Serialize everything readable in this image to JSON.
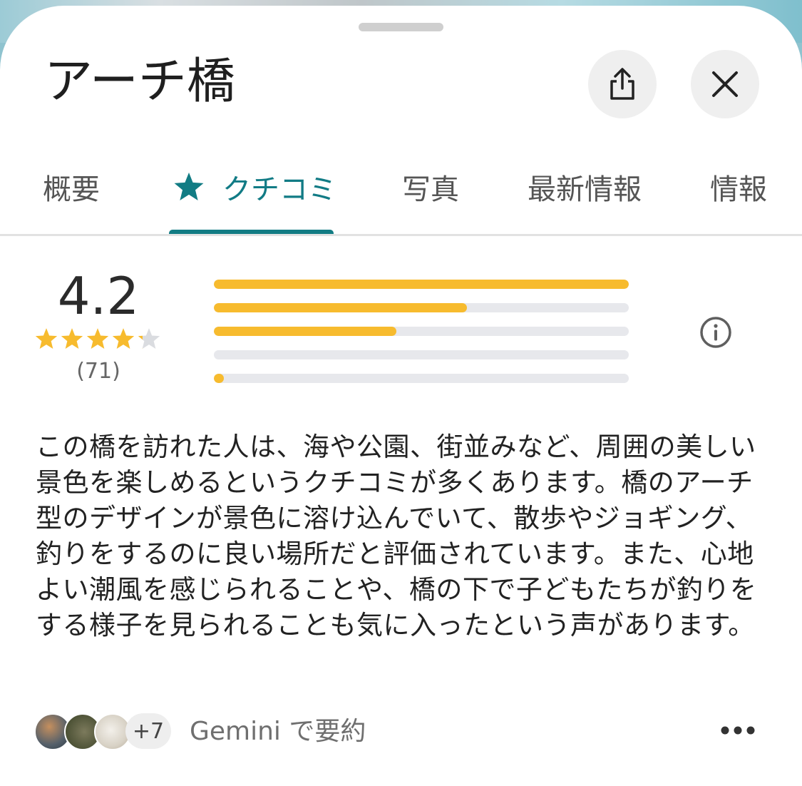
{
  "header": {
    "title": "アーチ橋",
    "share_icon": "share-icon",
    "close_icon": "close-icon"
  },
  "tabs": [
    {
      "label": "概要",
      "active": false
    },
    {
      "label": "クチコミ",
      "active": true,
      "icon": "star-icon"
    },
    {
      "label": "写真",
      "active": false
    },
    {
      "label": "最新情報",
      "active": false
    },
    {
      "label": "情報",
      "active": false
    }
  ],
  "rating": {
    "score": "4.2",
    "stars_value": 4.2,
    "stars_max": 5,
    "count": "(71)",
    "distribution": [
      {
        "stars": 5,
        "fraction": 1.0
      },
      {
        "stars": 4,
        "fraction": 0.61
      },
      {
        "stars": 3,
        "fraction": 0.44
      },
      {
        "stars": 2,
        "fraction": 0.0
      },
      {
        "stars": 1,
        "fraction": 0.02
      }
    ],
    "info_icon": "info-icon"
  },
  "summary": {
    "text": "この橋を訪れた人は、海や公園、街並みなど、周囲の美しい景色を楽しめるというクチコミが多くあります。橋のアーチ型のデザインが景色に溶け込んでいて、散歩やジョギング、釣りをするのに良い場所だと評価されています。また、心地よい潮風を感じられることや、橋の下で子どもたちが釣りをする様子を見られることも気に入ったという声があります。"
  },
  "footer": {
    "more_count": "+7",
    "gemini_label": "Gemini で要約",
    "more_icon": "more-horizontal-icon"
  },
  "colors": {
    "accent": "#127c84",
    "star": "#f7bb2e",
    "bar_track": "#e7e8ec"
  }
}
